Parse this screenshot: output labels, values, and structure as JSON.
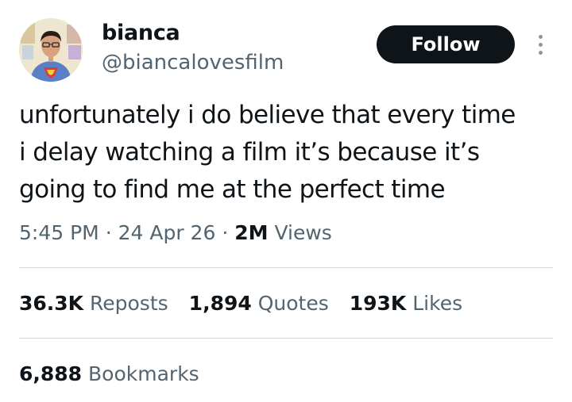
{
  "user": {
    "display_name": "bianca",
    "handle": "@biancalovesfilm",
    "avatar_icon": "profile-photo"
  },
  "actions": {
    "follow_label": "Follow",
    "more_icon": "more-vertical-icon"
  },
  "tweet": {
    "lines": [
      "unfortunately i do believe that every time",
      "i delay watching a film it’s because it’s",
      "going to find me at the perfect time"
    ]
  },
  "meta": {
    "time": "5:45 PM",
    "date": "24 Apr 26",
    "views_count": "2M",
    "views_label": "Views",
    "separator": "·"
  },
  "stats": {
    "reposts_count": "36.3K",
    "reposts_label": "Reposts",
    "quotes_count": "1,894",
    "quotes_label": "Quotes",
    "likes_count": "193K",
    "likes_label": "Likes",
    "bookmarks_count": "6,888",
    "bookmarks_label": "Bookmarks"
  },
  "colors": {
    "text_primary": "#0f1419",
    "text_secondary": "#536471",
    "divider": "#cfd9de",
    "button_bg": "#0f1419",
    "button_text": "#ffffff"
  }
}
